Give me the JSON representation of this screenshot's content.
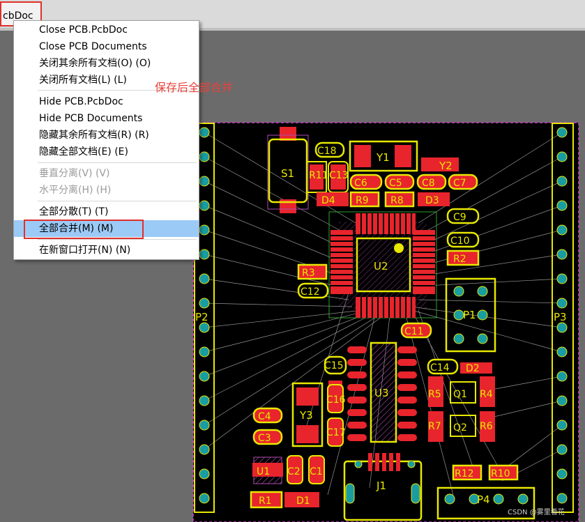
{
  "tab": {
    "title": "cbDoc"
  },
  "menu": {
    "items": [
      {
        "label": "Close PCB.PcbDoc",
        "state": "normal"
      },
      {
        "label": "Close PCB Documents",
        "state": "normal"
      },
      {
        "label": "关闭其余所有文档(O) (O)",
        "state": "normal"
      },
      {
        "label": "关闭所有文档(L) (L)",
        "state": "normal"
      },
      {
        "label": "Hide PCB.PcbDoc",
        "state": "normal"
      },
      {
        "label": "Hide PCB Documents",
        "state": "normal"
      },
      {
        "label": "隐藏其余所有文档(R) (R)",
        "state": "normal"
      },
      {
        "label": "隐藏全部文档(E) (E)",
        "state": "normal"
      },
      {
        "label": "垂直分离(V) (V)",
        "state": "disabled"
      },
      {
        "label": "水平分离(H) (H)",
        "state": "disabled"
      },
      {
        "label": "全部分散(T) (T)",
        "state": "normal"
      },
      {
        "label": "全部合并(M) (M)",
        "state": "highlighted"
      },
      {
        "label": "在新窗口打开(N) (N)",
        "state": "normal"
      }
    ]
  },
  "annotation": {
    "text": "保存后全部合并",
    "color": "#e8413a"
  },
  "watermark": {
    "text": "CSDN @雾里看花"
  },
  "pcb": {
    "headers": {
      "left": "P2",
      "right": "P3"
    },
    "components": {
      "s1": "S1",
      "c18": "C18",
      "y1": "Y1",
      "y2": "Y2",
      "r11": "R11",
      "c13": "C13",
      "c6": "C6",
      "c5": "C5",
      "c8": "C8",
      "c7": "C7",
      "d4": "D4",
      "r9": "R9",
      "r8": "R8",
      "d3": "D3",
      "c9": "C9",
      "c10": "C10",
      "r2": "R2",
      "u2": "U2",
      "r3": "R3",
      "c12": "C12",
      "p1": "P1",
      "c11": "C11",
      "c15": "C15",
      "u3": "U3",
      "c14": "C14",
      "d2": "D2",
      "r5": "R5",
      "q1": "Q1",
      "r4": "R4",
      "c16": "C16",
      "y3": "Y3",
      "r7": "R7",
      "q2": "Q2",
      "r6": "R6",
      "c4": "C4",
      "c3": "C3",
      "c17": "C17",
      "u1": "U1",
      "c2": "C2",
      "c1": "C1",
      "j1": "J1",
      "r12": "R12",
      "r10": "R10",
      "r1": "R1",
      "d1": "D1",
      "p4": "P4"
    }
  },
  "colors": {
    "board": "#000000",
    "outline": "#e8e800",
    "pad": "#e8242c",
    "via": "#1a9da0",
    "highlight": "#9ccaf6",
    "annotation": "#e0302a"
  }
}
